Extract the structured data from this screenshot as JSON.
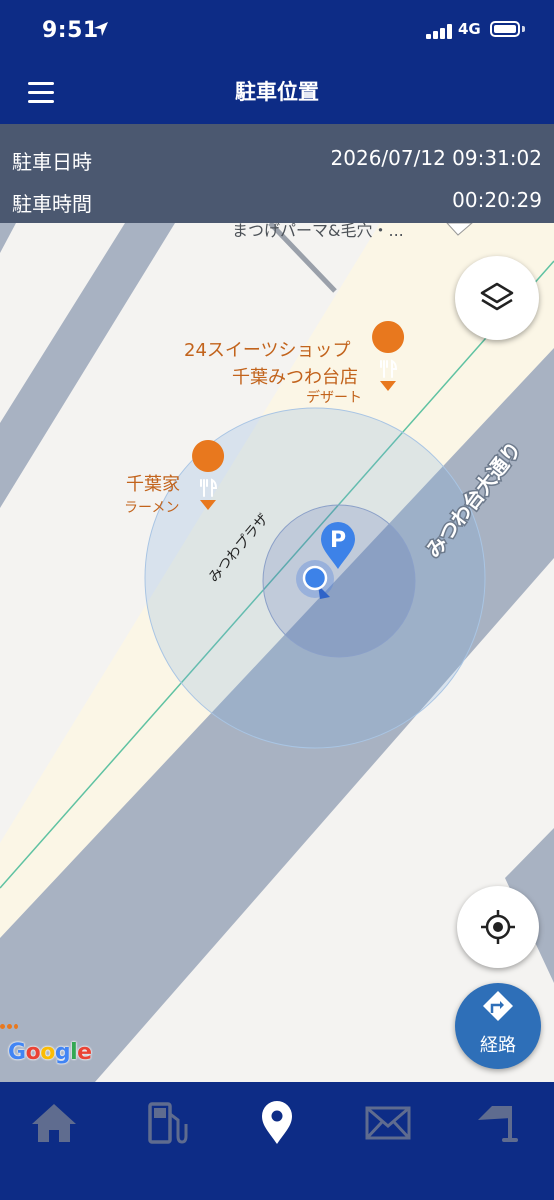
{
  "status_bar": {
    "time": "9:51",
    "network": "4G"
  },
  "header": {
    "title": "駐車位置"
  },
  "info": {
    "parked_at_label": "駐車日時",
    "parked_at_value": "2026/07/12 09:31:02",
    "duration_label": "駐車時間",
    "duration_value": "00:20:29"
  },
  "map": {
    "pois": {
      "top_cut": "まつげパーマ&毛穴・...",
      "sweets_line1": "24スイーツショップ",
      "sweets_line2": "千葉みつわ台店",
      "sweets_category": "デザート",
      "ramen_name": "千葉家",
      "ramen_category": "ラーメン"
    },
    "streets": {
      "main": "みつわ台大通り",
      "plaza": "みつわプラザ"
    },
    "parking_marker": "P",
    "attribution": "Google"
  },
  "controls": {
    "route_label": "経路"
  },
  "nav": {
    "items": [
      "home",
      "fuel",
      "location",
      "mail",
      "parking-sign"
    ],
    "active": "location"
  },
  "colors": {
    "brand": "#0d2c86",
    "info_panel": "#4b5870",
    "poi_orange": "#e8781e",
    "route_button": "#2e6fb8",
    "marker_blue": "#3d82e8"
  }
}
